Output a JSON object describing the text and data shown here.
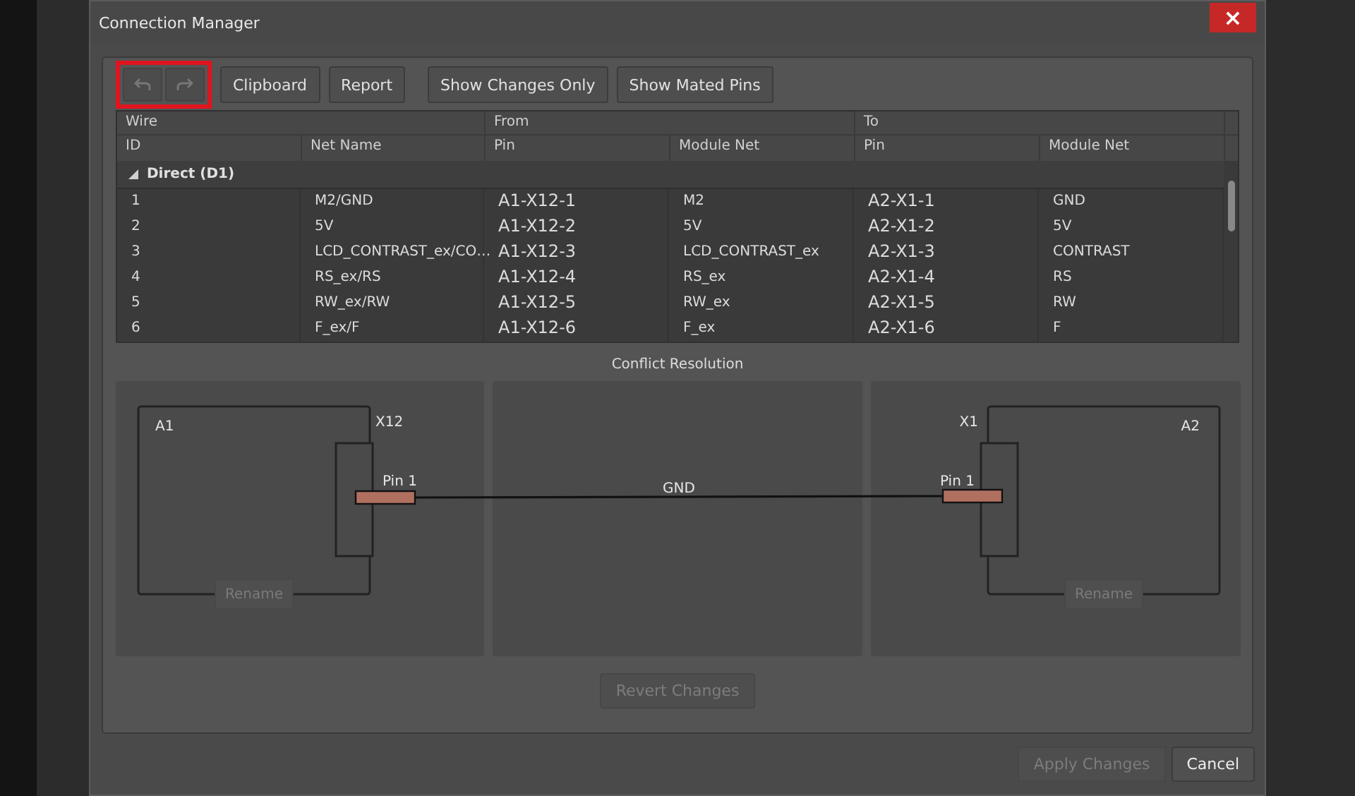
{
  "window": {
    "title": "Connection Manager",
    "close": "×"
  },
  "toolbar": {
    "highlighted": true,
    "history_buttons": [
      {
        "kind": "undo",
        "disabled": true
      },
      {
        "kind": "redo",
        "disabled": true
      }
    ],
    "button_groups": [
      [
        {
          "label": "Clipboard"
        },
        {
          "label": "Report"
        }
      ],
      [
        {
          "label": "Show Changes Only"
        },
        {
          "label": "Show Mated Pins"
        }
      ]
    ]
  },
  "table": {
    "column_groups": [
      {
        "label": "Wire"
      },
      {
        "label": "From"
      },
      {
        "label": "To"
      }
    ],
    "columns": [
      "ID",
      "Net Name",
      "Pin",
      "Module Net",
      "Pin",
      "Module Net"
    ],
    "groups": [
      {
        "label": "Direct (D1)",
        "expanded": true,
        "rows": [
          {
            "cells": [
              "1",
              "M2/GND",
              "A1-X12-1",
              "M2",
              "A2-X1-1",
              "GND"
            ]
          },
          {
            "cells": [
              "2",
              "5V",
              "A1-X12-2",
              "5V",
              "A2-X1-2",
              "5V"
            ]
          },
          {
            "cells": [
              "3",
              "LCD_CONTRAST_ex/CO…",
              "A1-X12-3",
              "LCD_CONTRAST_ex",
              "A2-X1-3",
              "CONTRAST"
            ]
          },
          {
            "cells": [
              "4",
              "RS_ex/RS",
              "A1-X12-4",
              "RS_ex",
              "A2-X1-4",
              "RS"
            ]
          },
          {
            "cells": [
              "5",
              "RW_ex/RW",
              "A1-X12-5",
              "RW_ex",
              "A2-X1-5",
              "RW"
            ]
          },
          {
            "cells": [
              "6",
              "F_ex/F",
              "A1-X12-6",
              "F_ex",
              "A2-X1-6",
              "F"
            ]
          }
        ]
      }
    ]
  },
  "conflict": {
    "title": "Conflict Resolution",
    "left": {
      "component": "A1",
      "connector": "X12",
      "pin": "Pin 1",
      "rename": {
        "label": "Rename",
        "disabled": true
      }
    },
    "wire": {
      "net": "GND"
    },
    "right": {
      "component": "A2",
      "connector": "X1",
      "pin": "Pin 1",
      "rename": {
        "label": "Rename",
        "disabled": true
      }
    },
    "revert": {
      "label": "Revert Changes",
      "disabled": true
    }
  },
  "footer": {
    "buttons": [
      {
        "label": "Apply Changes",
        "disabled": true
      },
      {
        "label": "Cancel",
        "disabled": false
      }
    ]
  }
}
